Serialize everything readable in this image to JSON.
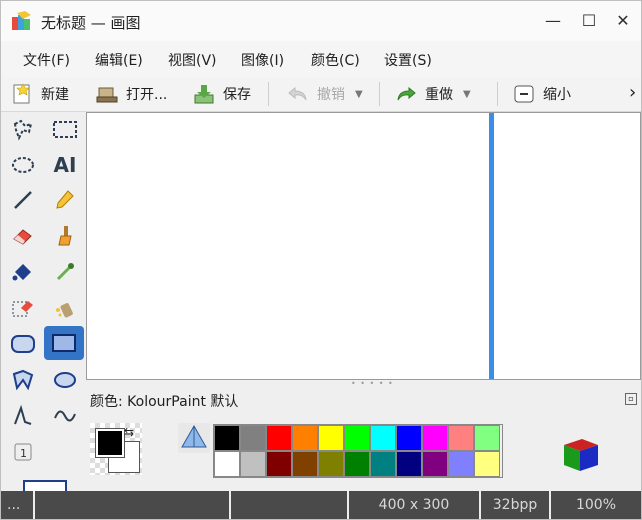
{
  "window": {
    "title": "无标题 — 画图",
    "controls": {
      "minimize": "—",
      "maximize": "☐",
      "close": "✕"
    }
  },
  "menu": [
    {
      "label": "文件(F)"
    },
    {
      "label": "编辑(E)"
    },
    {
      "label": "视图(V)"
    },
    {
      "label": "图像(I)"
    },
    {
      "label": "颜色(C)"
    },
    {
      "label": "设置(S)"
    }
  ],
  "toolbar": {
    "new_label": "新建",
    "open_label": "打开...",
    "save_label": "保存",
    "undo_label": "撤销",
    "redo_label": "重做",
    "zoom_out_label": "缩小",
    "overflow": "›"
  },
  "tools": [
    "free-selection-icon",
    "rect-selection-icon",
    "ellipse-selection-icon",
    "text-icon",
    "line-icon",
    "pen-icon",
    "eraser-icon",
    "brush-icon",
    "flood-fill-icon",
    "color-picker-icon",
    "color-eraser-icon",
    "spraycan-icon",
    "rounded-rect-icon",
    "rectangle-icon",
    "polygon-icon",
    "ellipse-icon",
    "polyline-icon",
    "curve-icon",
    "tool-option-icon"
  ],
  "text_tool_label": "AI",
  "colors": {
    "label": "颜色:",
    "scheme": "KolourPaint 默认",
    "foreground": "#000000",
    "background": "#ffffff",
    "palette_top": [
      "#000000",
      "#808080",
      "#ff0000",
      "#ff8000",
      "#ffff00",
      "#00ff00",
      "#00ffff",
      "#0000ff",
      "#ff00ff",
      "#ff8080",
      "#80ff80"
    ],
    "palette_bottom": [
      "#ffffff",
      "#c0c0c0",
      "#800000",
      "#804000",
      "#808000",
      "#008000",
      "#008080",
      "#000080",
      "#800080",
      "#8080ff",
      "#ffff80"
    ]
  },
  "status": {
    "cell1": "...",
    "size": "400 x 300",
    "depth": "32bpp",
    "zoom": "100%"
  },
  "accent": "#3474c7"
}
